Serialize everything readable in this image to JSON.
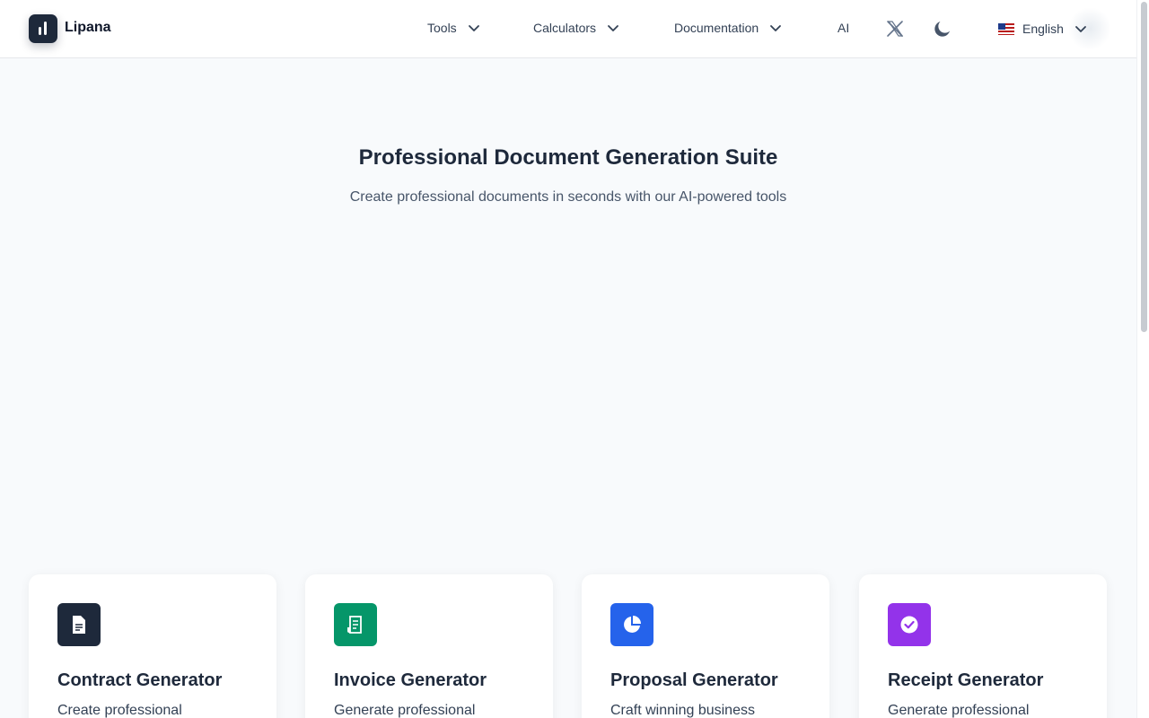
{
  "header": {
    "logo_text": "Lipana",
    "nav": [
      {
        "label": "Tools"
      },
      {
        "label": "Calculators"
      },
      {
        "label": "Documentation"
      },
      {
        "label": "AI"
      }
    ],
    "language": "English"
  },
  "hero": {
    "title": "Professional Document Generation Suite",
    "subtitle": "Create professional documents in seconds with our AI-powered tools"
  },
  "cards": [
    {
      "title": "Contract Generator",
      "desc": "Create professional",
      "icon": "document-icon",
      "color": "#1e293b"
    },
    {
      "title": "Invoice Generator",
      "desc": "Generate professional",
      "icon": "receipt-icon",
      "color": "#059669"
    },
    {
      "title": "Proposal Generator",
      "desc": "Craft winning business",
      "icon": "pie-chart-icon",
      "color": "#2563eb"
    },
    {
      "title": "Receipt Generator",
      "desc": "Generate professional",
      "icon": "check-badge-icon",
      "color": "#9333ea"
    }
  ],
  "colors": {
    "background": "#f8fafc",
    "brand_dark": "#1e293b"
  }
}
